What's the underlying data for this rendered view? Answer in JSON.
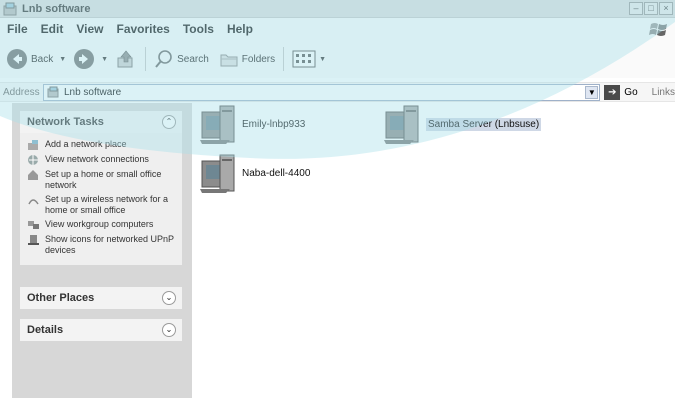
{
  "window": {
    "title": "Lnb software"
  },
  "menu": [
    "File",
    "Edit",
    "View",
    "Favorites",
    "Tools",
    "Help"
  ],
  "toolbar": {
    "back_label": "Back",
    "search_label": "Search",
    "folders_label": "Folders"
  },
  "address": {
    "label": "Address",
    "value": "Lnb software",
    "go_label": "Go",
    "links_label": "Links"
  },
  "network_tasks": {
    "title": "Network Tasks",
    "items": [
      {
        "label": "Add a network place",
        "icon": "add-network-place-icon"
      },
      {
        "label": "View network connections",
        "icon": "network-connections-icon"
      },
      {
        "label": "Set up a home or small office network",
        "icon": "home-network-icon"
      },
      {
        "label": "Set up a wireless network for a home or small office",
        "icon": "wireless-icon"
      },
      {
        "label": "View workgroup computers",
        "icon": "workgroup-icon"
      },
      {
        "label": "Show icons for networked UPnP devices",
        "icon": "upnp-icon"
      }
    ]
  },
  "other_places": {
    "title": "Other Places"
  },
  "details": {
    "title": "Details"
  },
  "computers": [
    {
      "name": "Emily-lnbp933",
      "selected": false
    },
    {
      "name": "Samba Server (Lnbsuse)",
      "selected": true
    },
    {
      "name": "Naba-dell-4400",
      "selected": false
    }
  ],
  "colors": {
    "panel_background": "#d7d7d7",
    "overlay_tint": "#a9dfe9"
  }
}
